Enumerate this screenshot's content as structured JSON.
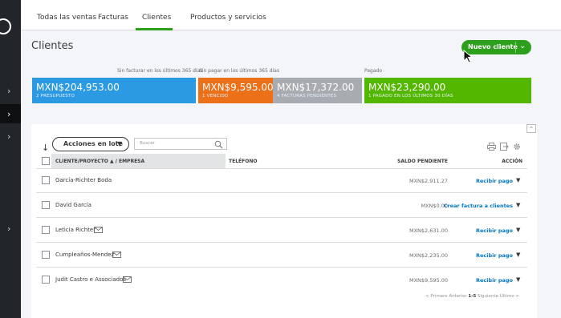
{
  "tabs": [
    {
      "label": "Todas las ventas"
    },
    {
      "label": "Facturas"
    },
    {
      "label": "Clientes"
    },
    {
      "label": "Productos y servicios"
    }
  ],
  "page_title": "Clientes",
  "new_customer_button": "Nuevo cliente",
  "money_bar": {
    "unbilled_caption": "Sin facturar en los últimos 365 días",
    "unpaid_caption": "Sin pagar en los últimos 365 días",
    "paid_caption": "Pagado",
    "estimates": {
      "amount": "MXN$204,953.00",
      "label": "2 PRESUPUESTO",
      "color": "#2c9ae2"
    },
    "overdue": {
      "amount": "MXN$9,595.00",
      "label": "1 VENCIDO",
      "color": "#ec7018"
    },
    "open": {
      "amount": "MXN$17,372.00",
      "label": "4 FACTURAS PENDIENTES",
      "color": "#a8acb0"
    },
    "paid": {
      "amount": "MXN$23,290.00",
      "label": "1 PAGADO EN LOS ÚLTIMOS 30 DÍAS",
      "color": "#53b700"
    }
  },
  "toolbar": {
    "batch_actions": "Acciones en lote",
    "search_placeholder": "Buscar"
  },
  "table": {
    "headers": {
      "customer": "CLIENTE/PROYECTO ▲ / EMPRESA",
      "phone": "TELÉFONO",
      "balance": "SALDO PENDIENTE",
      "action": "ACCIÓN"
    },
    "rows": [
      {
        "name": "García-Richter Boda",
        "balance": "MXN$2,911.27",
        "action": "Recibir pago",
        "has_mail": false
      },
      {
        "name": "David García",
        "balance": "MXN$0.00",
        "action": "Crear factura a clientes",
        "has_mail": false
      },
      {
        "name": "Leticia Richter",
        "balance": "MXN$2,631.00",
        "action": "Recibir pago",
        "has_mail": true
      },
      {
        "name": "Cumpleaños-Mendez",
        "balance": "MXN$2,235.00",
        "action": "Recibir pago",
        "has_mail": true
      },
      {
        "name": "Judit Castro e Associados",
        "balance": "MXN$9,595.00",
        "action": "Recibir pago",
        "has_mail": true
      }
    ]
  },
  "pager": {
    "first": "< Primero",
    "prev": "Anterior",
    "range": "1-5",
    "next": "Siguiente",
    "last": "Último >"
  }
}
